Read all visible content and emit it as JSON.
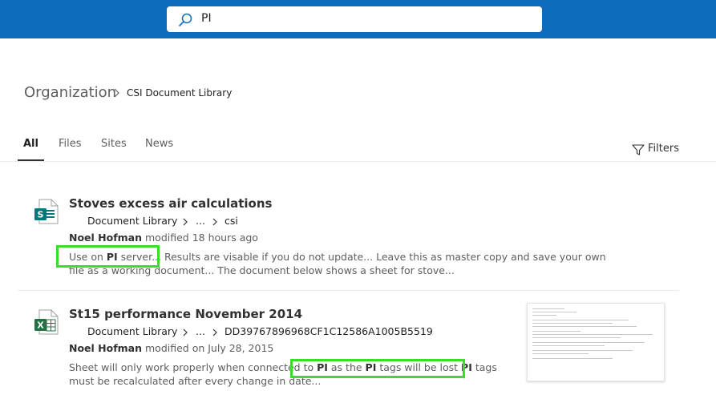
{
  "search": {
    "query": "PI"
  },
  "breadcrumb": {
    "organization": "Organization",
    "library": "CSI Document Library"
  },
  "tabs": [
    {
      "label": "All",
      "active": true
    },
    {
      "label": "Files",
      "active": false
    },
    {
      "label": "Sites",
      "active": false
    },
    {
      "label": "News",
      "active": false
    }
  ],
  "filters": {
    "label": "Filters"
  },
  "colors": {
    "accent": "#0f6cbd",
    "highlight": "#3bdc2c",
    "sway": "#03787c",
    "excel": "#217346"
  },
  "results": [
    {
      "title": "Stoves excess air calculations",
      "icon": "sway-file-icon",
      "path": [
        "Document Library",
        "...",
        "csi"
      ],
      "author": "Noel Hofman",
      "modified": "modified 18 hours ago",
      "snippet": {
        "prefix": "Use on ",
        "term": "PI",
        "text": " server... Results are visable if you do not update... Leave this as master copy and save your own file as a working document... The document below shows a sheet for stove..."
      }
    },
    {
      "title": "St15 performance November 2014",
      "icon": "excel-file-icon",
      "path": [
        "Document Library",
        "...",
        "DD39767896968CF1C12586A1005B5519"
      ],
      "author": "Noel Hofman",
      "modified": "modified on July 28, 2015",
      "snippet": {
        "prefix": "Sheet will only work properly when connected to ",
        "term1": "PI",
        "mid1": " as the ",
        "term2": "PI",
        "mid2": " tags will be lost ",
        "term3": "PI",
        "suffix": " tags must be recalculated after every change in date..."
      }
    }
  ]
}
